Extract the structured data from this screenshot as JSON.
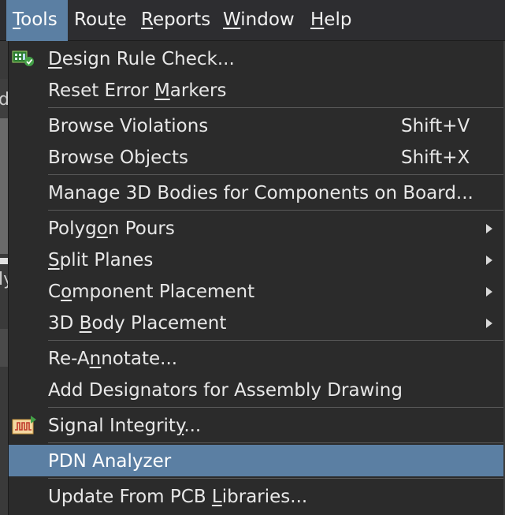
{
  "menubar": {
    "items": [
      {
        "pre": "",
        "u": "T",
        "post": "ools"
      },
      {
        "pre": "Rou",
        "u": "t",
        "post": "e"
      },
      {
        "pre": "",
        "u": "R",
        "post": "eports"
      },
      {
        "pre": "",
        "u": "W",
        "post": "indow"
      },
      {
        "pre": "",
        "u": "H",
        "post": "elp"
      }
    ]
  },
  "background": {
    "edge_text_1": "d",
    "edge_text_2": "ly"
  },
  "menu": {
    "items": [
      {
        "pre": "",
        "u": "D",
        "post": "esign Rule Check...",
        "shortcut": "",
        "submenu": false,
        "icon": "design-rule-check-icon"
      },
      {
        "pre": "Reset Error ",
        "u": "M",
        "post": "arkers",
        "shortcut": "",
        "submenu": false
      },
      {
        "pre": "Browse Violations",
        "u": "",
        "post": "",
        "shortcut": "Shift+V",
        "submenu": false
      },
      {
        "pre": "Browse Objects",
        "u": "",
        "post": "",
        "shortcut": "Shift+X",
        "submenu": false
      },
      {
        "pre": "Manage 3D Bodies for Components on Board...",
        "u": "",
        "post": "",
        "shortcut": "",
        "submenu": false
      },
      {
        "pre": "Polyg",
        "u": "o",
        "post": "n Pours",
        "shortcut": "",
        "submenu": true
      },
      {
        "pre": "",
        "u": "S",
        "post": "plit Planes",
        "shortcut": "",
        "submenu": true
      },
      {
        "pre": "C",
        "u": "o",
        "post": "mponent Placement",
        "shortcut": "",
        "submenu": true
      },
      {
        "pre": "3D ",
        "u": "B",
        "post": "ody Placement",
        "shortcut": "",
        "submenu": true
      },
      {
        "pre": "Re-A",
        "u": "n",
        "post": "notate...",
        "shortcut": "",
        "submenu": false
      },
      {
        "pre": "Add Designators for Assembly Drawing",
        "u": "",
        "post": "",
        "shortcut": "",
        "submenu": false
      },
      {
        "pre": "Signal Integrit",
        "u": "y",
        "post": "...",
        "shortcut": "",
        "submenu": false,
        "icon": "signal-integrity-icon"
      },
      {
        "pre": "PDN Analyzer",
        "u": "",
        "post": "",
        "shortcut": "",
        "submenu": false,
        "highlighted": true
      },
      {
        "pre": "Update From PCB ",
        "u": "L",
        "post": "ibraries...",
        "shortcut": "",
        "submenu": false
      }
    ]
  },
  "colors": {
    "highlight": "#5b7fa3",
    "menu_bg": "#2b2b2b",
    "separator": "#5a5a5a"
  }
}
